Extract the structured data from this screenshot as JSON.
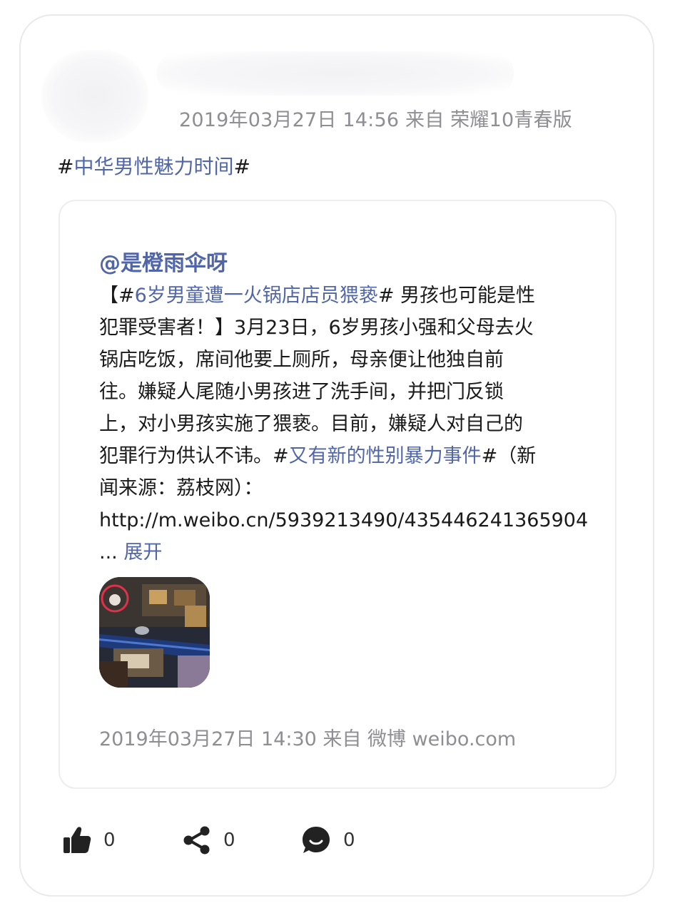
{
  "post": {
    "meta": "2019年03月27日 14:56 来自 荣耀10青春版",
    "topic_prefix": "#",
    "topic": "中华男性魅力时间",
    "topic_suffix": "#"
  },
  "repost": {
    "author": "@是橙雨伞呀",
    "lines": [
      {
        "a": "【#",
        "link": "6岁男童遭一火锅店店员猥亵",
        "b": "# 男孩也可能是性"
      },
      {
        "a": "犯罪受害者！】3月23日，6岁男孩小强和父母去火"
      },
      {
        "a": "锅店吃饭，席间他要上厕所，母亲便让他独自前"
      },
      {
        "a": "往。嫌疑人尾随小男孩进了洗手间，并把门反锁"
      },
      {
        "a": "上，对小男孩实施了猥亵。目前，嫌疑人对自己的"
      },
      {
        "a": "犯罪行为供认不讳。#",
        "link": "又有新的性别暴力事件",
        "b": "#（新"
      },
      {
        "a": "闻来源：荔枝网）："
      },
      {
        "a": "http://m.weibo.cn/5939213490/435446241365904"
      }
    ],
    "ellipsis": "... ",
    "expand_label": "展开",
    "meta": "2019年03月27日 14:30 来自 微博 weibo.com"
  },
  "actions": {
    "like_count": "0",
    "share_count": "0",
    "comment_count": "0"
  },
  "colors": {
    "link": "#5066a9",
    "meta": "#8e8e93",
    "border": "#e9e9ec"
  },
  "icons": {
    "like": "thumbs-up-icon",
    "share": "share-icon",
    "comment": "comment-icon"
  }
}
